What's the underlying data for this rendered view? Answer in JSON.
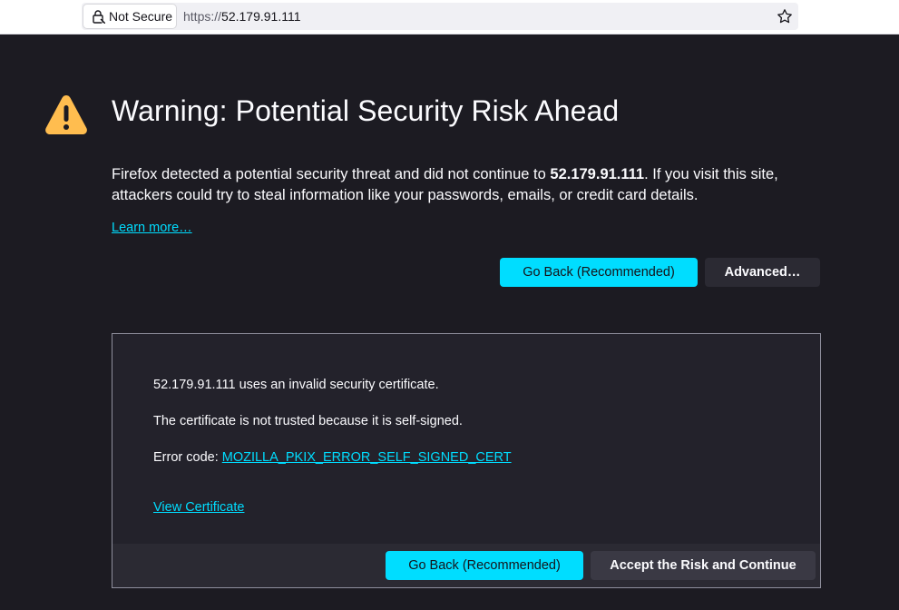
{
  "browser": {
    "security_chip": "Not Secure",
    "url_scheme": "https://",
    "url_host": "52.179.91.111",
    "icons": {
      "lock": "lock-warning-icon",
      "bookmark": "star-icon"
    }
  },
  "warning": {
    "icon": "warning-triangle-icon",
    "icon_color": "#ffbd4f",
    "title": "Warning: Potential Security Risk Ahead",
    "desc_before": "Firefox detected a potential security threat and did not continue to ",
    "desc_host": "52.179.91.111",
    "desc_after": ". If you visit this site, attackers could try to steal information like your passwords, emails, or credit card details.",
    "learn_more": "Learn more…",
    "go_back_label": "Go Back (Recommended)",
    "advanced_label": "Advanced…"
  },
  "advanced_panel": {
    "line1": "52.179.91.111 uses an invalid security certificate.",
    "line2": "The certificate is not trusted because it is self-signed.",
    "error_prefix": "Error code: ",
    "error_code": "MOZILLA_PKIX_ERROR_SELF_SIGNED_CERT",
    "view_certificate": "View Certificate",
    "go_back_label": "Go Back (Recommended)",
    "accept_label": "Accept the Risk and Continue"
  },
  "colors": {
    "background": "#1c1b22",
    "accent": "#00ddff",
    "button_secondary": "#2b2a33"
  }
}
